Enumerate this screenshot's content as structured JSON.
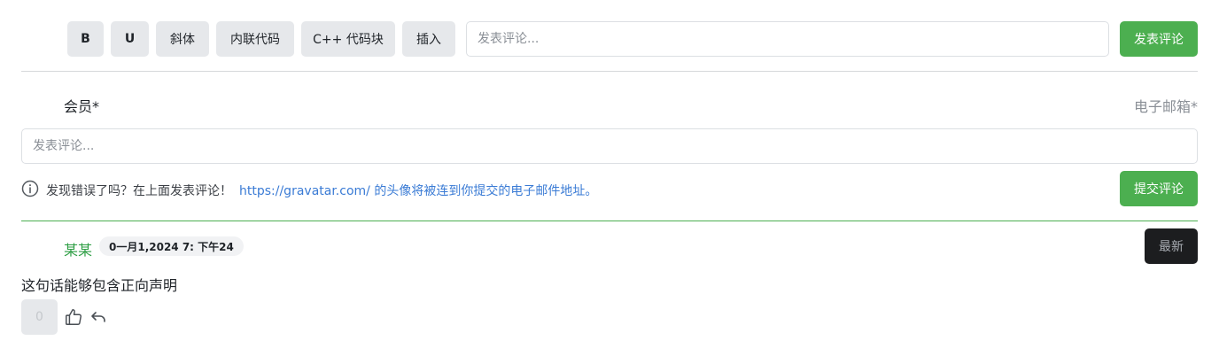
{
  "toolbar": {
    "bold_label": "B",
    "underline_label": "U",
    "italic_label": "斜体",
    "inline_code_label": "内联代码",
    "cpp_block_label": "C++ 代码块",
    "insert_label": "插入",
    "input_placeholder": "发表评论...",
    "post_label": "发表评论"
  },
  "form": {
    "member_label": "会员*",
    "email_label": "电子邮箱*",
    "comment_placeholder": "发表评论...",
    "info_text": "发现错误了吗？在上面发表评论！",
    "info_link_text": "https://gravatar.com/ 的头像将被连到你提交的电子邮件地址。",
    "submit_label": "提交评论"
  },
  "icons": {
    "info": "info-circle-icon",
    "like": "thumbs-up-icon",
    "reply": "reply-arrow-icon"
  },
  "comment": {
    "author": "某某",
    "date": "0一月1,2024 7: 下午24",
    "text": "这句话能够包含正向声明",
    "votes": "0",
    "sort_label": "最新"
  },
  "colors": {
    "accent_green": "#4caf50",
    "link_blue": "#3a7bd5",
    "author_green": "#2e9e44",
    "dark_button": "#1c1d1f"
  }
}
